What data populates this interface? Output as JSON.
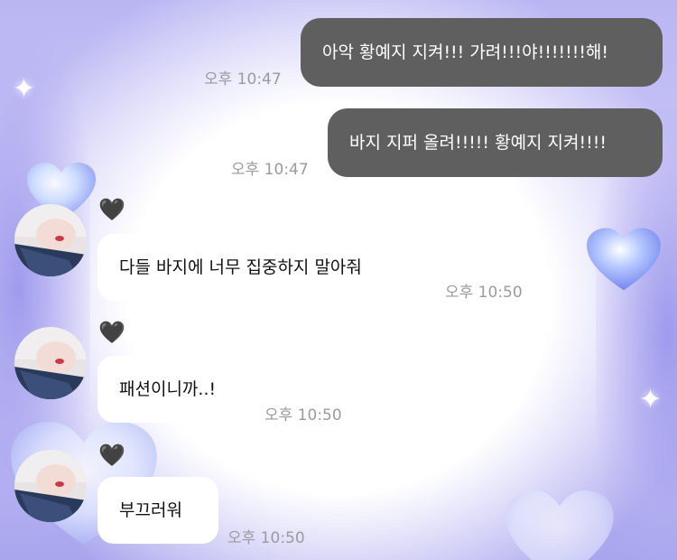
{
  "colors": {
    "outgoing_bubble": "#5f5f5f",
    "outgoing_text": "#ffffff",
    "incoming_bubble": "#ffffff",
    "incoming_text": "#111111",
    "timestamp": "#9a9aa0",
    "background_lavender": "#c0bcf5"
  },
  "messages_out": [
    {
      "text": "아악 황예지 지켜!!! 가려!!!야!!!!!!!해!",
      "time": "오후 10:47"
    },
    {
      "text": "바지 지퍼 올려!!!!! 황예지 지켜!!!!",
      "time": "오후 10:47"
    }
  ],
  "messages_in": [
    {
      "badge": "🖤",
      "text": "다들 바지에 너무 집중하지 말아줘",
      "time": "오후 10:50"
    },
    {
      "badge": "🖤",
      "text": "패션이니까..!",
      "time": "오후 10:50"
    },
    {
      "badge": "🖤",
      "text": "부끄러워",
      "time": "오후 10:50"
    }
  ],
  "icons": [
    "sparkle-icon",
    "heart-decoration",
    "black-heart-icon",
    "profile-avatar"
  ]
}
